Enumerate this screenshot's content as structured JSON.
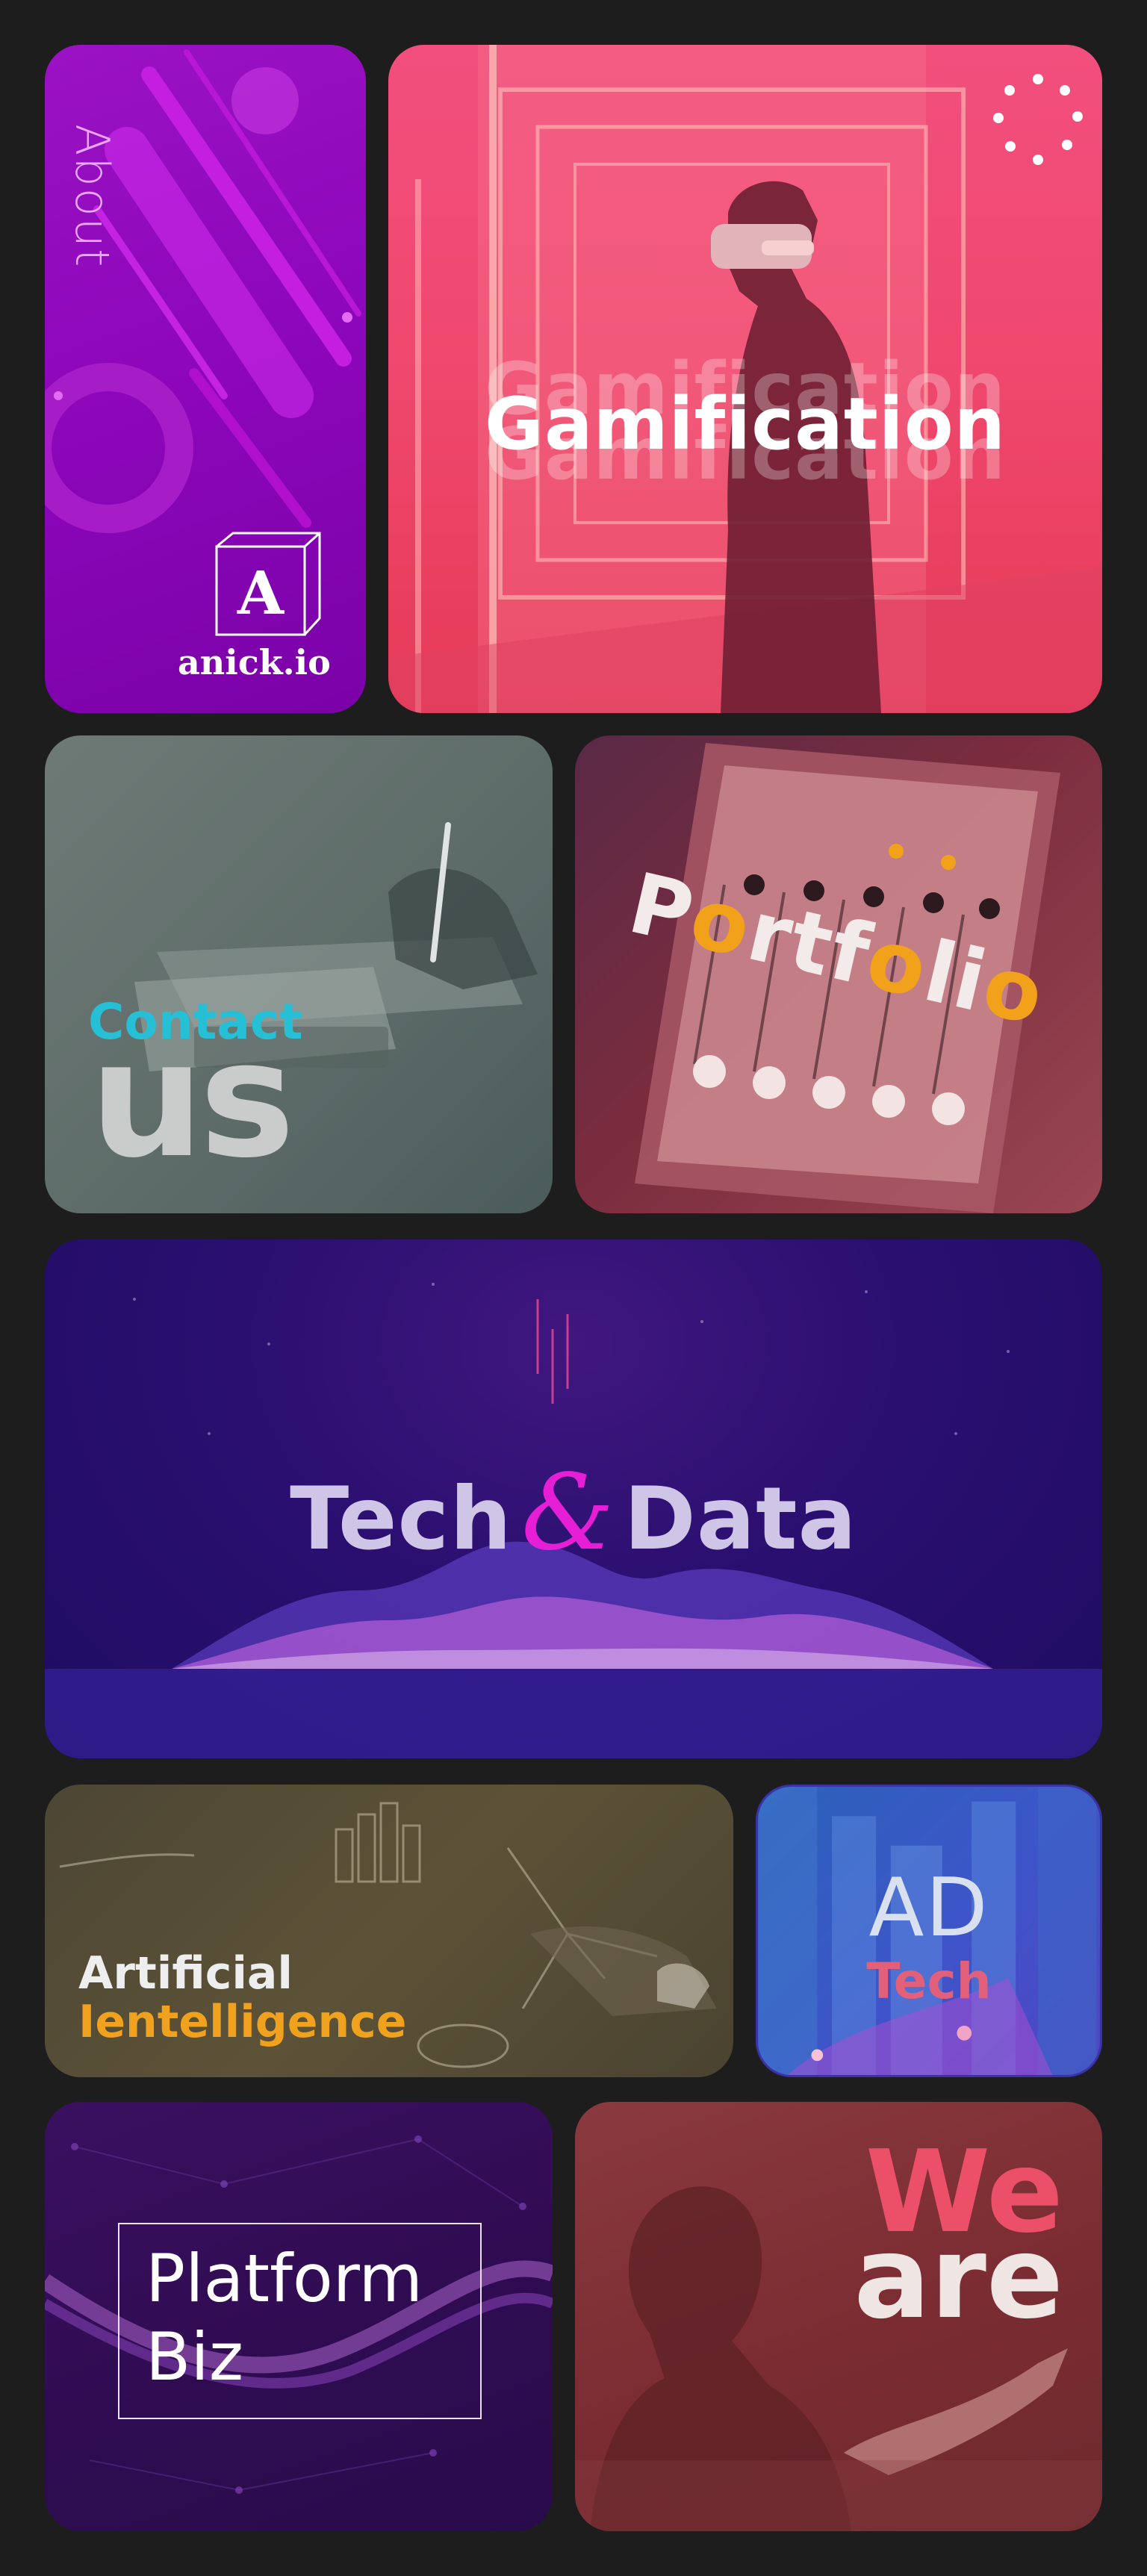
{
  "about": {
    "label": "About",
    "brand": "anick.io",
    "logo_letter": "A"
  },
  "gamification": {
    "title": "Gamification",
    "ghost": "Gamification"
  },
  "contact": {
    "small": "Contact",
    "big": "us"
  },
  "portfolio": {
    "word": [
      "P",
      "o",
      "r",
      "t",
      "f",
      "o",
      "l",
      "i",
      "o"
    ]
  },
  "techdata": {
    "left": "Tech",
    "amp": "&",
    "right": "Data"
  },
  "ai": {
    "line1": "Artificial",
    "line2": "Ientelligence"
  },
  "adtech": {
    "line1": "AD",
    "line2": "Tech"
  },
  "platform": {
    "line1": "Platform",
    "line2": "Biz"
  },
  "weare": {
    "line1": "We",
    "line2": "are"
  },
  "colors": {
    "page_bg": "#1d1d1d",
    "about_purple": "#8a06b8",
    "gamification_pink": "#f0486f",
    "contact_cyan": "#25bfd6",
    "portfolio_orange": "#f2a21a",
    "techdata_magenta": "#e61fd7",
    "ai_gold": "#f0a21e",
    "adtech_red": "#e2607a",
    "weare_red": "#ec5068"
  }
}
